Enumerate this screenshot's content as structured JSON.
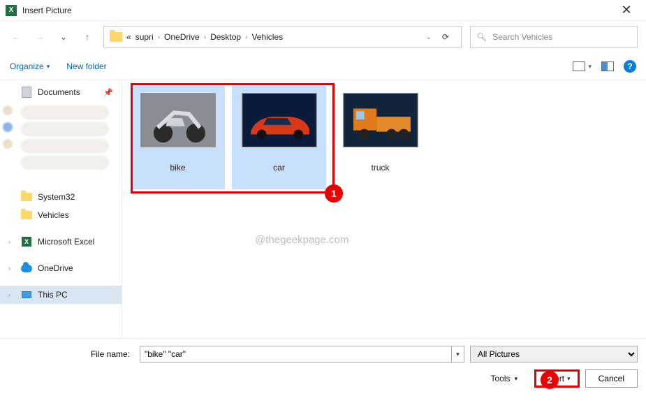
{
  "window": {
    "title": "Insert Picture"
  },
  "breadcrumb": {
    "prefix": "«",
    "items": [
      "supri",
      "OneDrive",
      "Desktop",
      "Vehicles"
    ]
  },
  "search": {
    "placeholder": "Search Vehicles"
  },
  "toolbar": {
    "organize": "Organize",
    "newfolder": "New folder"
  },
  "sidebar": {
    "documents": "Documents",
    "system32": "System32",
    "vehicles": "Vehicles",
    "excel": "Microsoft Excel",
    "onedrive": "OneDrive",
    "thispc": "This PC"
  },
  "files": [
    {
      "name": "bike",
      "selected": true
    },
    {
      "name": "car",
      "selected": true
    },
    {
      "name": "truck",
      "selected": false
    }
  ],
  "watermark": "@thegeekpage.com",
  "footer": {
    "filename_label": "File name:",
    "filename_value": "\"bike\" \"car\"",
    "filter": "All Pictures",
    "tools": "Tools",
    "insert": "Insert",
    "cancel": "Cancel"
  },
  "callouts": {
    "one": "1",
    "two": "2"
  }
}
